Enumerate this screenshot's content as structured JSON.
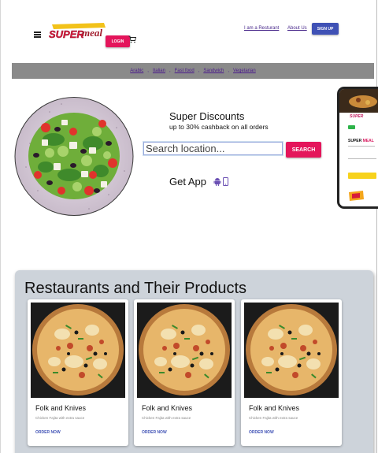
{
  "header": {
    "logo_alt": "SUPERmeal",
    "login_label": "LOGIN",
    "links": [
      {
        "label": "I am a Resturant"
      },
      {
        "label": "About Us"
      }
    ],
    "signup_label": "SIGN UP"
  },
  "categories": [
    "Arabic",
    "Italian",
    "Fast food",
    "Sandwich",
    "Vegetarian"
  ],
  "hero": {
    "title": "Super Discounts",
    "subtitle": "up to 30% cashback on all orders",
    "search_placeholder": "Search location...",
    "search_button": "SEARCH",
    "get_app": "Get App"
  },
  "phone_mockup": {
    "brand_left": "SUPER",
    "brand_right": "MEAL"
  },
  "restaurants": {
    "title": "Restaurants and Their Products",
    "cards": [
      {
        "name": "Folk and Knives",
        "description": "Chicken Fajita with extra sauce",
        "cta": "ORDER NOW"
      },
      {
        "name": "Folk and Knives",
        "description": "Chicken Fajita with extra sauce",
        "cta": "ORDER NOW"
      },
      {
        "name": "Folk and Knives",
        "description": "Chicken Fajita with extra sauce",
        "cta": "ORDER NOW"
      }
    ]
  },
  "colors": {
    "primary_pink": "#e4155b",
    "primary_blue": "#3f51b5",
    "category_bar": "#8a8a8a",
    "section_bg": "#cdd3da"
  },
  "icons": [
    "menu-icon",
    "cart-icon",
    "android-icon",
    "mobile-phone-icon"
  ]
}
